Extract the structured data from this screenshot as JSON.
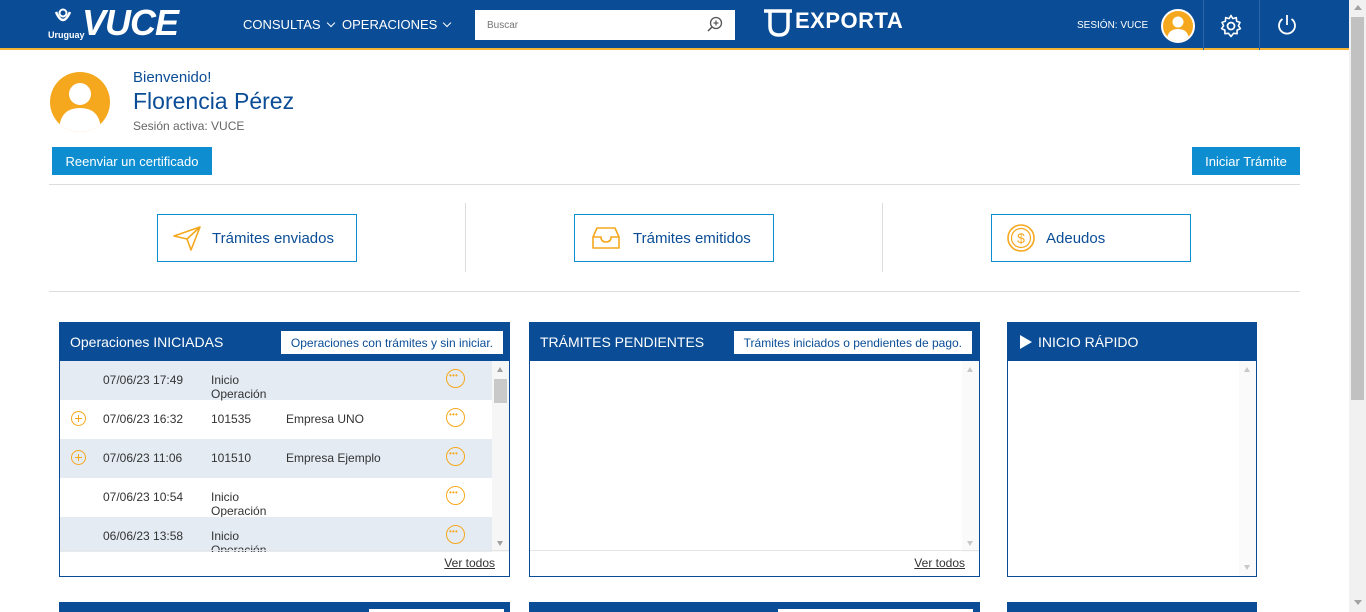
{
  "header": {
    "logo_country": "Uruguay",
    "logo_text": "VUCE",
    "nav": [
      {
        "label": "CONSULTAS"
      },
      {
        "label": "OPERACIONES"
      }
    ],
    "search_placeholder": "Buscar",
    "exporta_text": "EXPORTA",
    "session_label": "SESIÓN: VUCE"
  },
  "profile": {
    "greeting": "Bienvenido!",
    "name": "Florencia Pérez",
    "active_session": "Sesión activa: VUCE"
  },
  "actions": {
    "resend_certificate": "Reenviar un certificado",
    "start_procedure": "Iniciar Trámite"
  },
  "stats": [
    {
      "label": "Trámites enviados",
      "icon": "send-icon"
    },
    {
      "label": "Trámites emitidos",
      "icon": "inbox-icon"
    },
    {
      "label": "Adeudos",
      "icon": "dollar-coin-icon"
    }
  ],
  "panels": {
    "operations": {
      "title": "Operaciones INICIADAS",
      "tag": "Operaciones con trámites y sin iniciar.",
      "see_all": "Ver todos",
      "rows": [
        {
          "date": "07/06/23 17:49",
          "code": "Inicio Operación",
          "company": "",
          "expandable": false
        },
        {
          "date": "07/06/23 16:32",
          "code": "101535",
          "company": "Empresa UNO",
          "expandable": true
        },
        {
          "date": "07/06/23 11:06",
          "code": "101510",
          "company": "Empresa Ejemplo",
          "expandable": true
        },
        {
          "date": "07/06/23 10:54",
          "code": "Inicio Operación",
          "company": "",
          "expandable": false
        },
        {
          "date": "06/06/23 13:58",
          "code": "Inicio Operación",
          "company": "",
          "expandable": false
        }
      ]
    },
    "pending": {
      "title": "TRÁMITES PENDIENTES",
      "tag": "Trámites iniciados o pendientes de pago.",
      "see_all": "Ver todos"
    },
    "quick": {
      "title": "INICIO RÁPIDO"
    }
  },
  "colors": {
    "brand_blue": "#0a4d96",
    "accent_blue": "#0e8ed1",
    "accent_orange": "#f5a81d",
    "row_alt": "#e4ebf3"
  }
}
